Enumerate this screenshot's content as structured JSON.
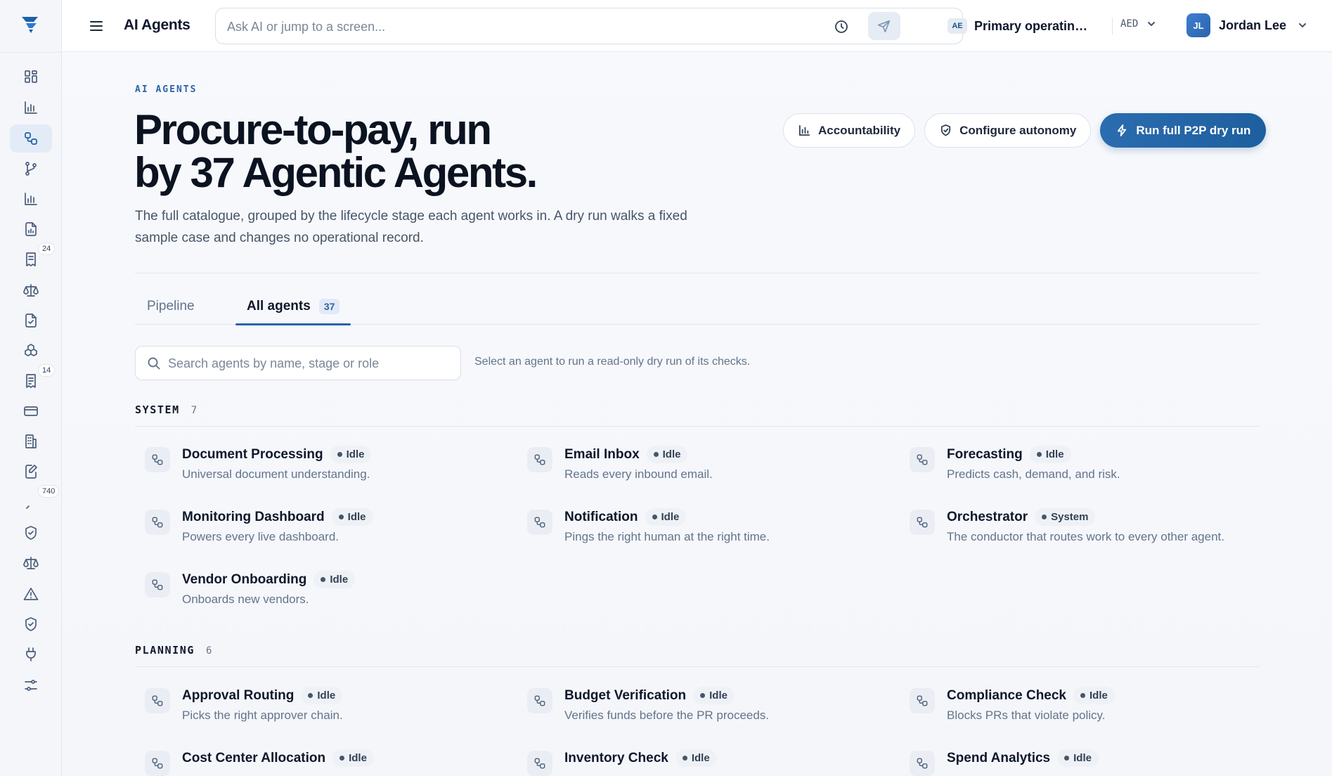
{
  "app": {
    "title": "AI Agents"
  },
  "ask": {
    "placeholder": "Ask AI or jump to a screen..."
  },
  "entity": {
    "flag": "AE",
    "name": "Primary operating e...",
    "currency": "AED"
  },
  "user": {
    "initials": "JL",
    "name": "Jordan Lee"
  },
  "rail": {
    "items": [
      {
        "icon": "grid-icon"
      },
      {
        "icon": "bar-chart-icon"
      },
      {
        "icon": "agents-icon",
        "active": true
      },
      {
        "icon": "branch-icon"
      },
      {
        "icon": "bar-chart-icon"
      },
      {
        "icon": "report-icon"
      },
      {
        "icon": "receipt-icon",
        "badge": "24"
      },
      {
        "icon": "scale-icon"
      },
      {
        "icon": "file-check-icon"
      },
      {
        "icon": "boxes-icon"
      },
      {
        "icon": "invoice-icon",
        "badge": "14"
      },
      {
        "icon": "card-icon"
      },
      {
        "icon": "building-icon"
      },
      {
        "icon": "file-edit-icon"
      },
      {
        "icon": "misc-icon",
        "badge": "740"
      },
      {
        "icon": "shield-check-icon"
      },
      {
        "icon": "scale-icon"
      },
      {
        "icon": "warning-icon"
      },
      {
        "icon": "shield-check-icon"
      },
      {
        "icon": "plug-icon"
      },
      {
        "icon": "sliders-icon"
      }
    ]
  },
  "hero": {
    "eyebrow": "AI AGENTS",
    "headline_line1": "Procure-to-pay, run",
    "headline_line2": "by 37 Agentic Agents.",
    "subtitle": "The full catalogue, grouped by the lifecycle stage each agent works in. A dry run walks a fixed sample case and changes no operational record.",
    "actions": {
      "accountability": "Accountability",
      "configure": "Configure autonomy",
      "run": "Run full P2P dry run"
    }
  },
  "tabs": {
    "pipeline": "Pipeline",
    "all": "All agents",
    "all_count": "37"
  },
  "search": {
    "placeholder": "Search agents by name, stage or role",
    "hint": "Select an agent to run a read-only dry run of its checks."
  },
  "sections": {
    "system": {
      "name": "SYSTEM",
      "count": "7",
      "agents": [
        {
          "name": "Document Processing",
          "status": "Idle",
          "desc": "Universal document understanding."
        },
        {
          "name": "Email Inbox",
          "status": "Idle",
          "desc": "Reads every inbound email."
        },
        {
          "name": "Forecasting",
          "status": "Idle",
          "desc": "Predicts cash, demand, and risk."
        },
        {
          "name": "Monitoring Dashboard",
          "status": "Idle",
          "desc": "Powers every live dashboard."
        },
        {
          "name": "Notification",
          "status": "Idle",
          "desc": "Pings the right human at the right time."
        },
        {
          "name": "Orchestrator",
          "status": "System",
          "desc": "The conductor that routes work to every other agent."
        },
        {
          "name": "Vendor Onboarding",
          "status": "Idle",
          "desc": "Onboards new vendors."
        }
      ]
    },
    "planning": {
      "name": "PLANNING",
      "count": "6",
      "agents": [
        {
          "name": "Approval Routing",
          "status": "Idle",
          "desc": "Picks the right approver chain."
        },
        {
          "name": "Budget Verification",
          "status": "Idle",
          "desc": "Verifies funds before the PR proceeds."
        },
        {
          "name": "Compliance Check",
          "status": "Idle",
          "desc": "Blocks PRs that violate policy."
        },
        {
          "name": "Cost Center Allocation",
          "status": "Idle",
          "desc": ""
        },
        {
          "name": "Inventory Check",
          "status": "Idle",
          "desc": ""
        },
        {
          "name": "Spend Analytics",
          "status": "Idle",
          "desc": ""
        }
      ]
    }
  }
}
